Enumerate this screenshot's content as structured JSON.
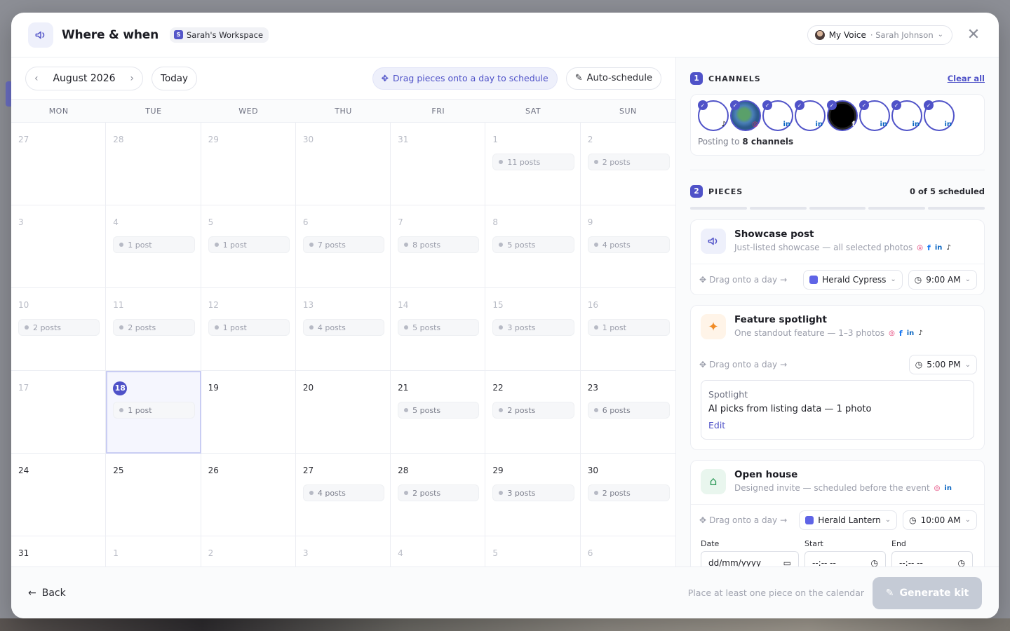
{
  "header": {
    "title": "Where & when",
    "workspace": "Sarah's Workspace",
    "workspace_initial": "S",
    "voice_label": "My Voice",
    "voice_user": "Sarah Johnson"
  },
  "toolbar": {
    "month": "August 2026",
    "today": "Today",
    "drag_hint": "Drag pieces onto a day to schedule",
    "auto_schedule": "Auto-schedule"
  },
  "weekdays": [
    "MON",
    "TUE",
    "WED",
    "THU",
    "FRI",
    "SAT",
    "SUN"
  ],
  "days": [
    {
      "num": "27",
      "muted": true,
      "posts": ""
    },
    {
      "num": "28",
      "muted": true,
      "posts": ""
    },
    {
      "num": "29",
      "muted": true,
      "posts": ""
    },
    {
      "num": "30",
      "muted": true,
      "posts": ""
    },
    {
      "num": "31",
      "muted": true,
      "posts": ""
    },
    {
      "num": "1",
      "muted": true,
      "posts": "11 posts"
    },
    {
      "num": "2",
      "muted": true,
      "posts": "2 posts"
    },
    {
      "num": "3",
      "muted": true,
      "posts": ""
    },
    {
      "num": "4",
      "muted": true,
      "posts": "1 post"
    },
    {
      "num": "5",
      "muted": true,
      "posts": "1 post"
    },
    {
      "num": "6",
      "muted": true,
      "posts": "7 posts"
    },
    {
      "num": "7",
      "muted": true,
      "posts": "8 posts"
    },
    {
      "num": "8",
      "muted": true,
      "posts": "5 posts"
    },
    {
      "num": "9",
      "muted": true,
      "posts": "4 posts"
    },
    {
      "num": "10",
      "muted": true,
      "posts": "2 posts"
    },
    {
      "num": "11",
      "muted": true,
      "posts": "2 posts"
    },
    {
      "num": "12",
      "muted": true,
      "posts": "1 post"
    },
    {
      "num": "13",
      "muted": true,
      "posts": "4 posts"
    },
    {
      "num": "14",
      "muted": true,
      "posts": "5 posts"
    },
    {
      "num": "15",
      "muted": true,
      "posts": "3 posts"
    },
    {
      "num": "16",
      "muted": true,
      "posts": "1 post"
    },
    {
      "num": "17",
      "muted": true,
      "posts": ""
    },
    {
      "num": "18",
      "muted": false,
      "today": true,
      "posts": "1 post"
    },
    {
      "num": "19",
      "muted": false,
      "posts": ""
    },
    {
      "num": "20",
      "muted": false,
      "posts": ""
    },
    {
      "num": "21",
      "muted": false,
      "posts": "5 posts"
    },
    {
      "num": "22",
      "muted": false,
      "posts": "2 posts"
    },
    {
      "num": "23",
      "muted": false,
      "posts": "6 posts"
    },
    {
      "num": "24",
      "muted": false,
      "posts": ""
    },
    {
      "num": "25",
      "muted": false,
      "posts": ""
    },
    {
      "num": "26",
      "muted": false,
      "posts": ""
    },
    {
      "num": "27",
      "muted": false,
      "posts": "4 posts"
    },
    {
      "num": "28",
      "muted": false,
      "posts": "2 posts"
    },
    {
      "num": "29",
      "muted": false,
      "posts": "3 posts"
    },
    {
      "num": "30",
      "muted": false,
      "posts": "2 posts"
    },
    {
      "num": "31",
      "muted": false,
      "posts": ""
    },
    {
      "num": "1",
      "muted": true,
      "posts": ""
    },
    {
      "num": "2",
      "muted": true,
      "posts": ""
    },
    {
      "num": "3",
      "muted": true,
      "posts": ""
    },
    {
      "num": "4",
      "muted": true,
      "posts": ""
    },
    {
      "num": "5",
      "muted": true,
      "posts": ""
    },
    {
      "num": "6",
      "muted": true,
      "posts": ""
    }
  ],
  "channels": {
    "number": "1",
    "title": "CHANNELS",
    "clear_all": "Clear all",
    "posting_prefix": "Posting to",
    "posting_count": "8 channels",
    "items": [
      {
        "net": "tiktok-icon",
        "style": "plain"
      },
      {
        "net": "instagram-icon",
        "style": "earth"
      },
      {
        "net": "linkedin-icon",
        "style": "plain"
      },
      {
        "net": "linkedin-icon",
        "style": "plain"
      },
      {
        "net": "facebook-icon",
        "style": "dark"
      },
      {
        "net": "linkedin-icon",
        "style": "plain"
      },
      {
        "net": "linkedin-icon",
        "style": "plain"
      },
      {
        "net": "linkedin-icon",
        "style": "plain"
      }
    ]
  },
  "pieces": {
    "number": "2",
    "title": "PIECES",
    "status": "0 of 5 scheduled",
    "progress_segments": 5,
    "drag_onto": "Drag onto a day",
    "showcase": {
      "title": "Showcase post",
      "desc": "Just-listed showcase — all selected photos",
      "template": "Herald Cypress",
      "time": "9:00 AM"
    },
    "feature": {
      "title": "Feature spotlight",
      "desc": "One standout feature — 1–3 photos",
      "time": "5:00 PM",
      "spot_label": "Spotlight",
      "spot_desc": "AI picks from listing data — 1 photo",
      "spot_edit": "Edit"
    },
    "openhouse": {
      "title": "Open house",
      "desc": "Designed invite — scheduled before the event",
      "template": "Herald Lantern",
      "time": "10:00 AM",
      "date_label": "Date",
      "date_placeholder": "dd/mm/yyyy",
      "start_label": "Start",
      "start_placeholder": "--:-- --",
      "end_label": "End",
      "end_placeholder": "--:-- --"
    }
  },
  "footer": {
    "back": "Back",
    "hint": "Place at least one piece on the calendar",
    "generate": "Generate kit"
  },
  "colors": {
    "accent": "#4f52c8",
    "showcase_bg": "#eef0fb",
    "feature_bg": "#fff4e8",
    "openhouse_bg": "#e9f6ee"
  }
}
